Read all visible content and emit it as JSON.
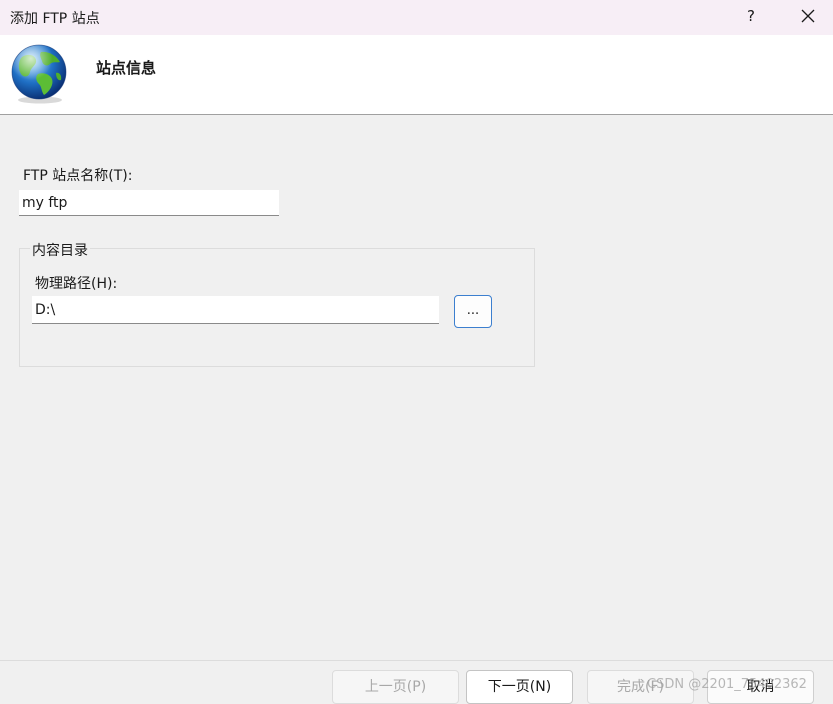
{
  "window": {
    "title": "添加 FTP 站点",
    "help_label": "?"
  },
  "header": {
    "title": "站点信息"
  },
  "form": {
    "site_name_label": "FTP 站点名称(T):",
    "site_name_value": "my ftp",
    "content_group_label": "内容目录",
    "physical_path_label": "物理路径(H):",
    "physical_path_value": "D:\\",
    "browse_label": "..."
  },
  "footer": {
    "prev_label": "上一页(P)",
    "next_label": "下一页(N)",
    "finish_label": "完成(F)",
    "cancel_label": "取消"
  },
  "watermark": "CSDN @2201_75402362",
  "icons": {
    "globe": "globe-icon",
    "close": "close-icon"
  },
  "colors": {
    "titlebar": "#f7eef6",
    "header_band": "#ffffff",
    "dialog_bg": "#f0f0f0",
    "focus_border": "#3c7fcf"
  }
}
